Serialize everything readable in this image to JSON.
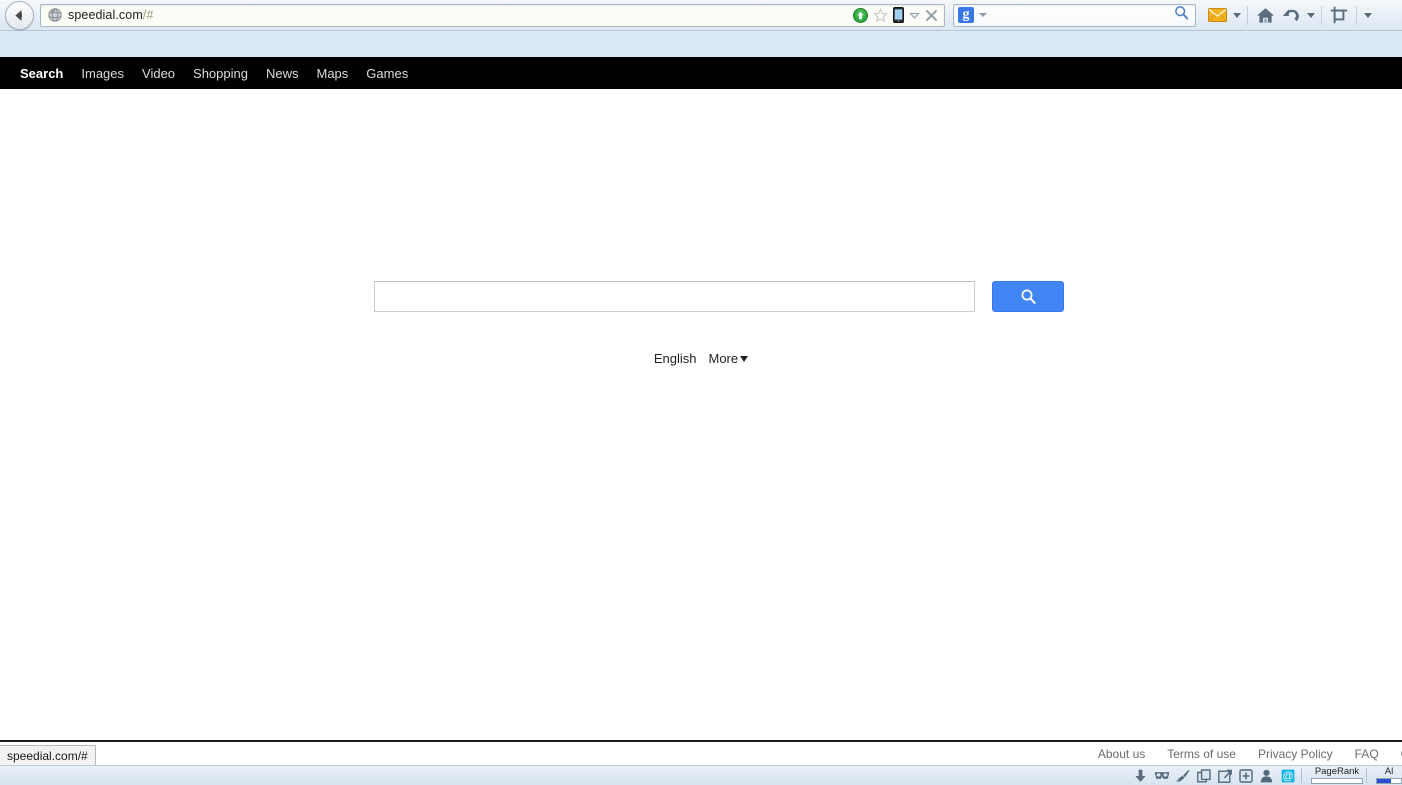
{
  "browser": {
    "back_button": "back-button",
    "url": "speedial.com",
    "url_fragment": "/#",
    "favicon": "globe-icon",
    "url_actions": [
      "download-manager-icon",
      "bookmark-star-icon",
      "mobile-view-icon",
      "dropdown-caret-icon",
      "close-icon"
    ],
    "search_box": {
      "engine": "g",
      "value": "",
      "placeholder": ""
    },
    "right_buttons": [
      "mail-icon",
      "home-icon",
      "undo-icon",
      "crop-icon"
    ]
  },
  "nav": {
    "items": [
      {
        "label": "Search",
        "active": true
      },
      {
        "label": "Images",
        "active": false
      },
      {
        "label": "Video",
        "active": false
      },
      {
        "label": "Shopping",
        "active": false
      },
      {
        "label": "News",
        "active": false
      },
      {
        "label": "Maps",
        "active": false
      },
      {
        "label": "Games",
        "active": false
      }
    ]
  },
  "main": {
    "search": {
      "value": "",
      "placeholder": "",
      "button_icon": "search-icon"
    },
    "language": {
      "current": "English",
      "more_label": "More"
    }
  },
  "footer": {
    "links": [
      "About us",
      "Terms of use",
      "Privacy Policy",
      "FAQ",
      "Co"
    ]
  },
  "status": {
    "text": "speedial.com/#"
  },
  "bottom_toolbar": {
    "icons": [
      "download-icon",
      "sunglasses-icon",
      "paintbrush-icon",
      "copy-icon",
      "share-icon",
      "save-icon",
      "person-icon",
      "at-sign-icon"
    ],
    "pagerank": {
      "label": "PageRank",
      "value": 0
    },
    "alexa": {
      "label": "Al",
      "value": 60
    }
  },
  "colors": {
    "accent_blue": "#4285f4",
    "nav_black": "#000000",
    "band_blue": "#dbe9f6",
    "google_blue": "#3b78e7"
  }
}
